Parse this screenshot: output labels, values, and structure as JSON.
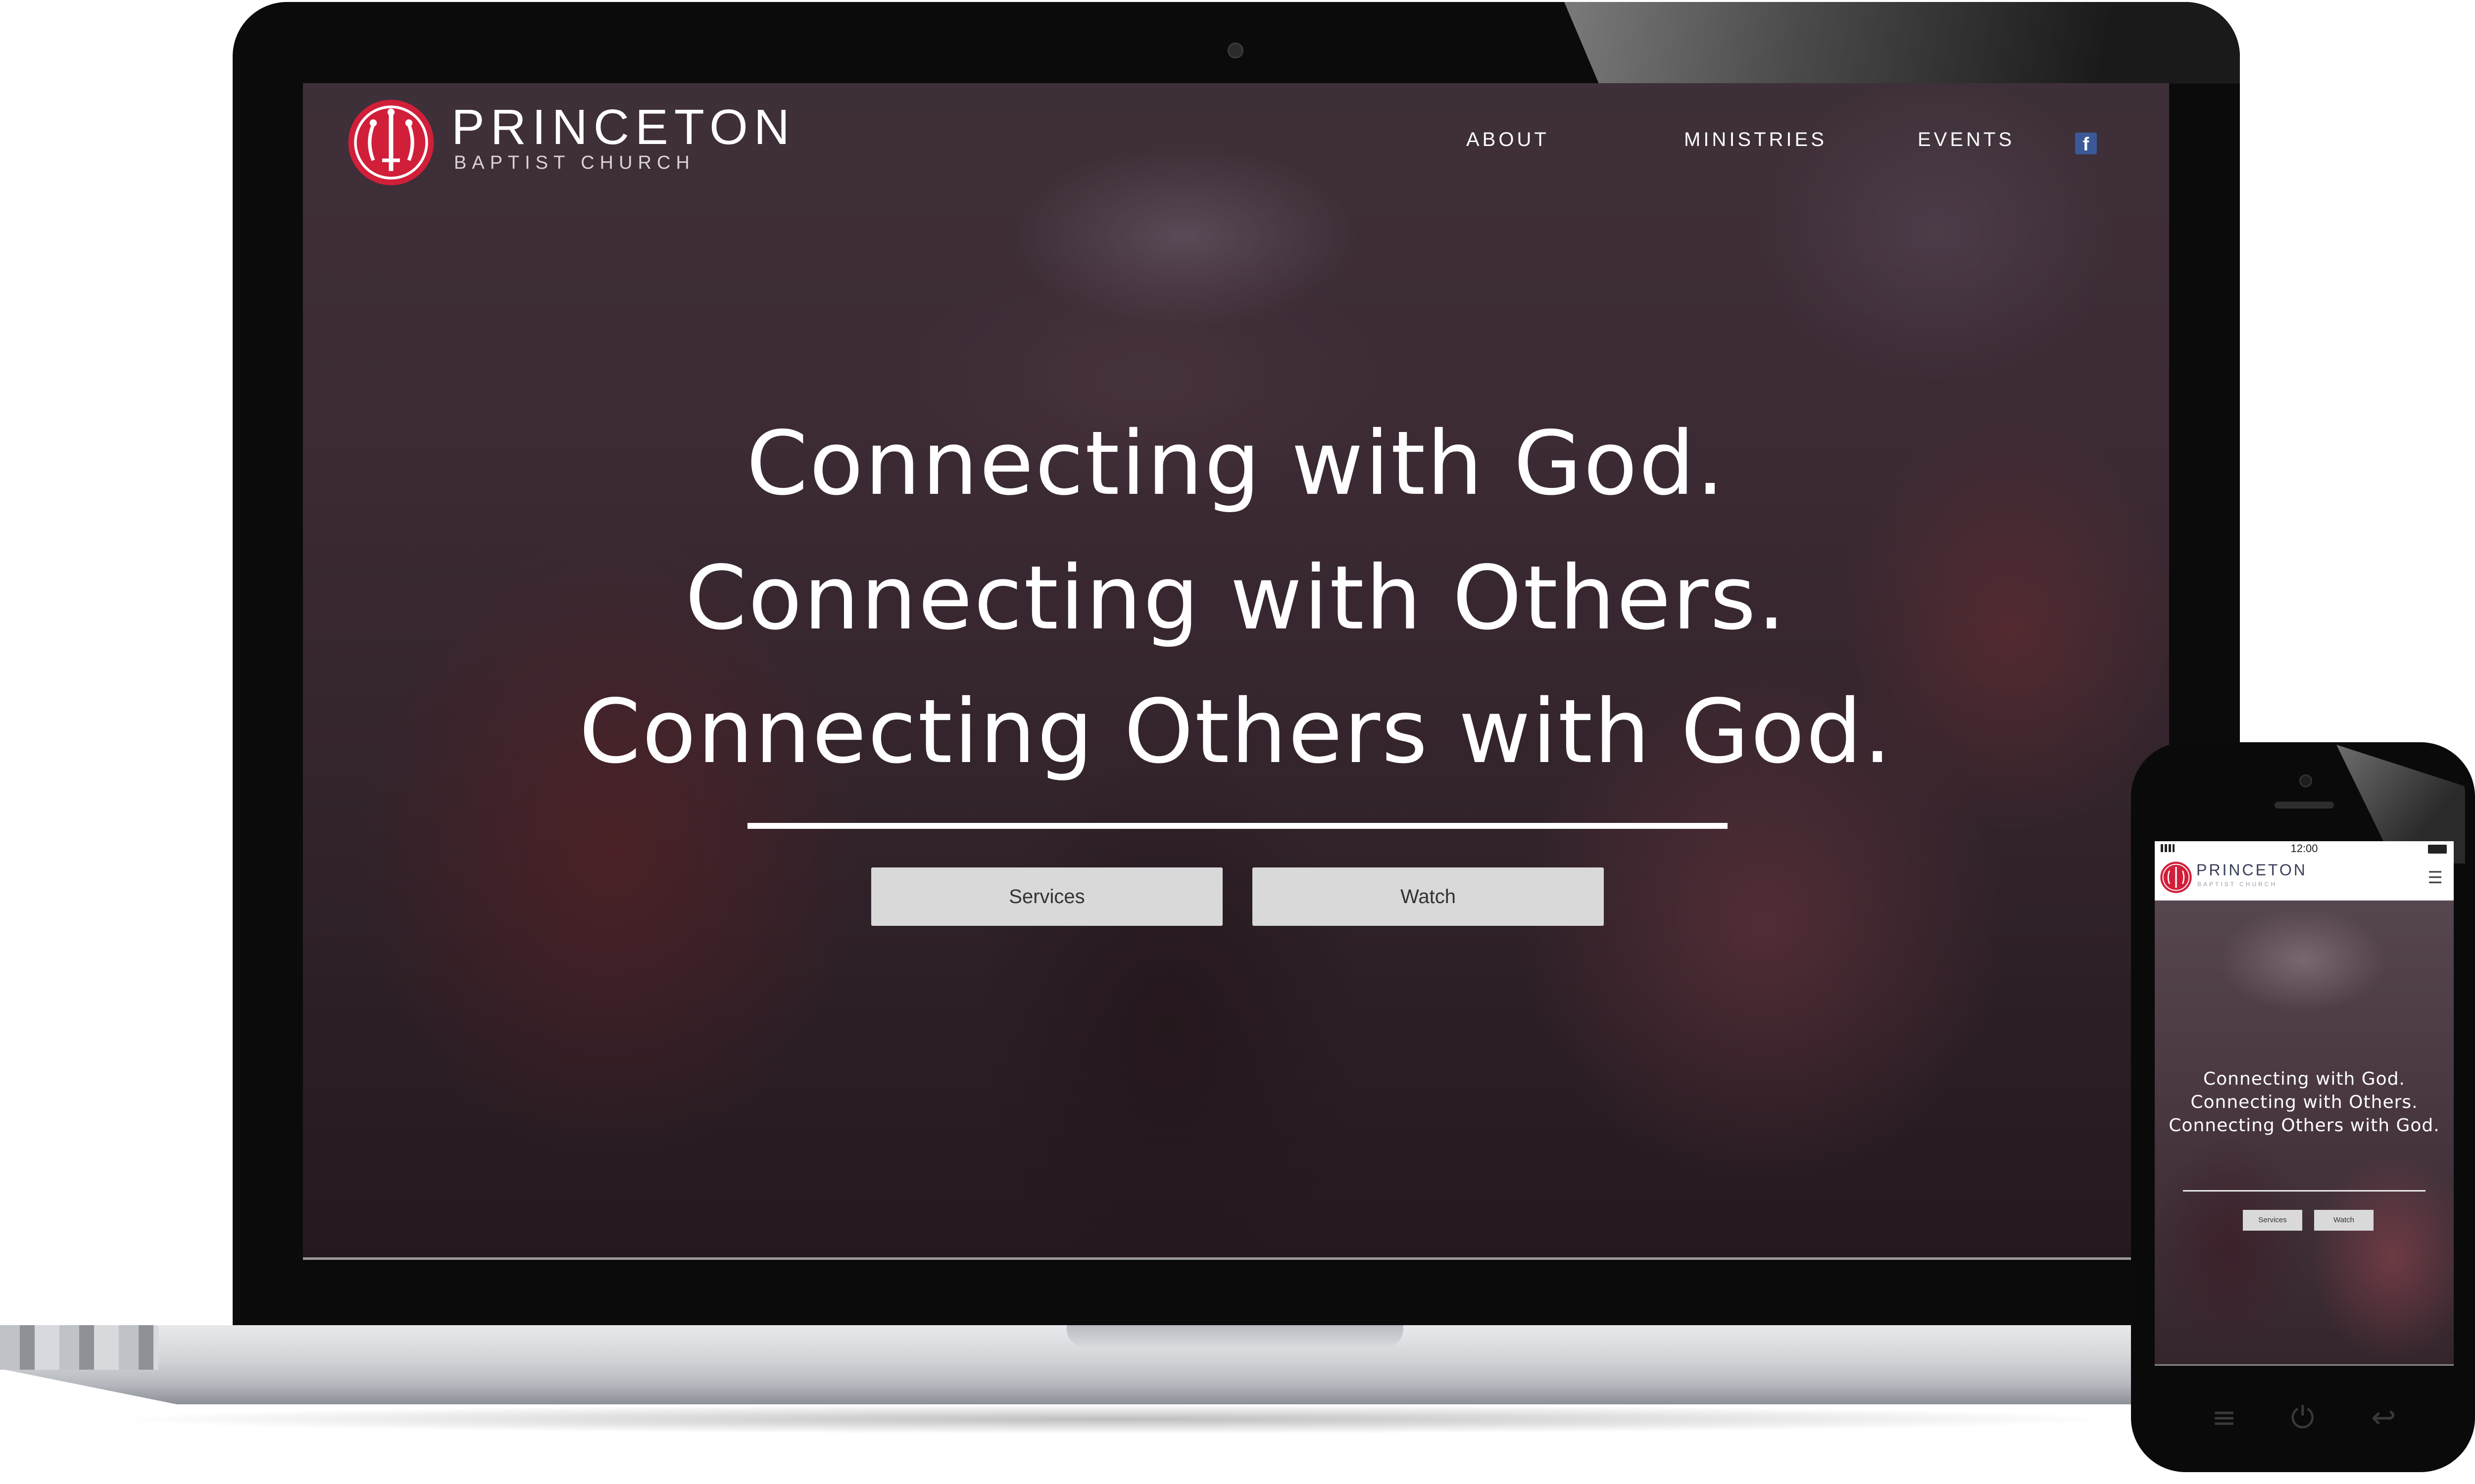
{
  "brand": {
    "name": "PRINCETON",
    "subtitle": "BAPTIST CHURCH",
    "accent_color": "#d11f3a"
  },
  "desktop": {
    "nav": [
      {
        "label": "ABOUT"
      },
      {
        "label": "MINISTRIES"
      },
      {
        "label": "EVENTS"
      }
    ],
    "social_icon": "facebook-icon",
    "facebook_glyph": "f",
    "hero": {
      "lines": [
        "Connecting with God.",
        "Connecting with Others.",
        "Connecting Others with God."
      ],
      "buttons": [
        {
          "label": "Services"
        },
        {
          "label": "Watch"
        }
      ]
    }
  },
  "mobile": {
    "status_time": "12:00",
    "menu_icon": "hamburger-menu-icon",
    "menu_glyph": "☰",
    "hero": {
      "lines": [
        "Connecting with God.",
        "Connecting with Others.",
        "Connecting Others with God."
      ],
      "buttons": [
        {
          "label": "Services"
        },
        {
          "label": "Watch"
        }
      ]
    },
    "hardware_buttons": [
      {
        "icon": "menu-icon",
        "glyph": "≡"
      },
      {
        "icon": "power-icon",
        "glyph": "⏻"
      },
      {
        "icon": "back-icon",
        "glyph": "↩"
      }
    ]
  }
}
